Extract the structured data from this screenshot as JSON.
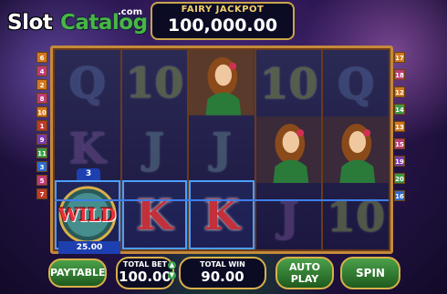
{
  "logo": {
    "word1": "Slot",
    "word2": "Catalog",
    "domain": ".com"
  },
  "jackpot": {
    "label": "FAIRY JACKPOT",
    "amount": "100,000.00"
  },
  "reels": [
    [
      "Q",
      "K",
      "WILD"
    ],
    [
      "10",
      "J",
      "K"
    ],
    [
      "fairy",
      "J",
      "K"
    ],
    [
      "10",
      "fairy",
      "J"
    ],
    [
      "Q",
      "fairy",
      "10"
    ]
  ],
  "lines_left": [
    "6",
    "4",
    "2",
    "8",
    "10",
    "1",
    "9",
    "11",
    "3",
    "5",
    "7"
  ],
  "lines_right": [
    "17",
    "18",
    "12",
    "14",
    "13",
    "15",
    "19",
    "20",
    "16"
  ],
  "win": {
    "line": "3",
    "amount": "25.00"
  },
  "controls": {
    "paytable_label": "PAYTABLE",
    "total_bet_label": "TOTAL BET",
    "total_bet_value": "100.00",
    "total_win_label": "TOTAL WIN",
    "total_win_value": "90.00",
    "auto_play_label": "AUTO PLAY",
    "spin_label": "SPIN"
  }
}
